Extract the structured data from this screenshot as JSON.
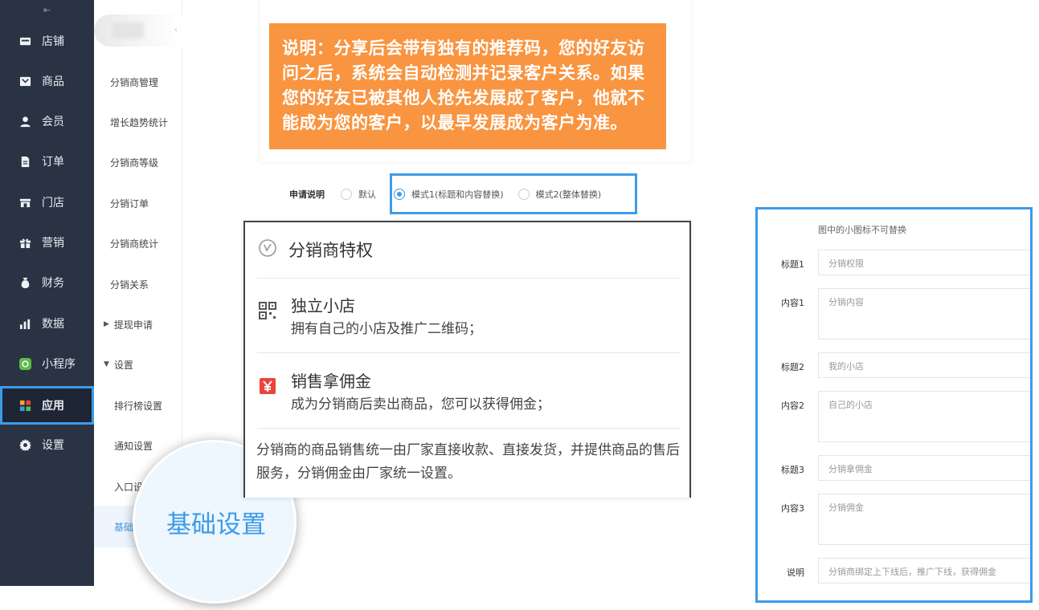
{
  "nav": {
    "toggle_icon": "menu-collapse-icon",
    "items": [
      {
        "label": "店铺",
        "icon": "store-icon"
      },
      {
        "label": "商品",
        "icon": "goods-icon"
      },
      {
        "label": "会员",
        "icon": "member-icon"
      },
      {
        "label": "订单",
        "icon": "order-icon"
      },
      {
        "label": "门店",
        "icon": "shop-icon"
      },
      {
        "label": "营销",
        "icon": "gift-icon"
      },
      {
        "label": "财务",
        "icon": "money-bag-icon"
      },
      {
        "label": "数据",
        "icon": "bar-chart-icon"
      },
      {
        "label": "小程序",
        "icon": "miniprogram-icon"
      },
      {
        "label": "应用",
        "icon": "apps-icon",
        "active": true
      },
      {
        "label": "设置",
        "icon": "gear-icon"
      }
    ]
  },
  "submenu": {
    "items": [
      {
        "label": "分销商管理"
      },
      {
        "label": "增长趋势统计"
      },
      {
        "label": "分销商等级"
      },
      {
        "label": "分销订单"
      },
      {
        "label": "分销商统计"
      },
      {
        "label": "分销关系"
      },
      {
        "label": "提现申请",
        "caret": "▶"
      },
      {
        "label": "设置",
        "caret": "▼"
      },
      {
        "label": "排行榜设置"
      },
      {
        "label": "通知设置"
      },
      {
        "label": "入口设"
      },
      {
        "label": "基础"
      }
    ]
  },
  "magnifier": {
    "label": "基础设置"
  },
  "notice": {
    "text": "说明：分享后会带有独有的推荐码，您的好友访问之后，系统会自动检测并记录客户关系。如果您的好友已被其他人抢先发展成了客户，他就不能成为您的客户，以最早发展成为客户为准。"
  },
  "apply_desc": {
    "label": "申请说明",
    "options": [
      {
        "label": "默认",
        "checked": false
      },
      {
        "label": "模式1(标题和内容替换)",
        "checked": true
      },
      {
        "label": "模式2(整体替换)",
        "checked": false
      }
    ]
  },
  "preview": {
    "header": "分销商特权",
    "blocks": [
      {
        "title": "独立小店",
        "desc": "拥有自己的小店及推广二维码；",
        "icon": "qrcode-icon"
      },
      {
        "title": "销售拿佣金",
        "desc": "成为分销商后卖出商品，您可以获得佣金；",
        "icon": "yen-icon"
      }
    ],
    "footer": "分销商的商品销售统一由厂家直接收款、直接发货，并提供商品的售后服务，分销佣金由厂家统一设置。",
    "accent": "#e8453c"
  },
  "form": {
    "hint": "图中的小图标不可替换",
    "fields": [
      {
        "label": "标题1",
        "value": "分销权限"
      },
      {
        "label": "内容1",
        "value": "分销内容"
      },
      {
        "label": "标题2",
        "value": "我的小店"
      },
      {
        "label": "内容2",
        "value": "自己的小店"
      },
      {
        "label": "标题3",
        "value": "分销拿佣金"
      },
      {
        "label": "内容3",
        "value": "分销佣金"
      },
      {
        "label": "说明",
        "value": "分销商绑定上下线后，推广下线，获得佣金"
      }
    ]
  },
  "colors": {
    "accent": "#3d9be8",
    "nav_bg": "#2a3344",
    "notice_bg": "#f99440"
  }
}
